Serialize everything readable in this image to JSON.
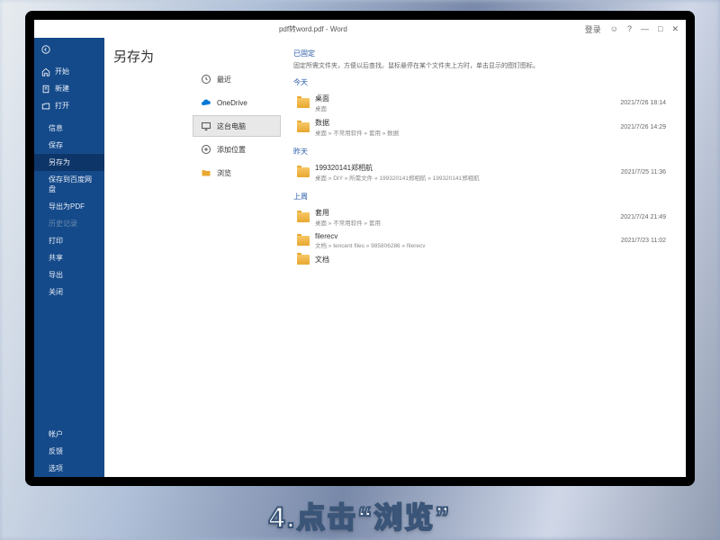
{
  "titlebar": {
    "doc": "pdf转word.pdf - Word",
    "login": "登录"
  },
  "sidebar": {
    "back": "",
    "top": [
      {
        "label": "开始"
      },
      {
        "label": "新建"
      },
      {
        "label": "打开"
      }
    ],
    "mid": [
      "信息",
      "保存",
      "另存为",
      "保存到百度网盘",
      "导出为PDF",
      "历史记录",
      "打印",
      "共享",
      "导出",
      "关闭"
    ],
    "bottom": [
      "帐户",
      "反馈",
      "选项"
    ],
    "active": "另存为"
  },
  "page": {
    "title": "另存为"
  },
  "nav": [
    {
      "label": "最近",
      "icon": "clock"
    },
    {
      "label": "OneDrive",
      "icon": "cloud"
    },
    {
      "label": "这台电脑",
      "icon": "pc",
      "selected": true
    },
    {
      "label": "添加位置",
      "icon": "plus"
    },
    {
      "label": "浏览",
      "icon": "folder"
    }
  ],
  "list": {
    "pinned_title": "已固定",
    "pinned_desc": "固定所需文件夹，方便以后查找。鼠标悬停在某个文件夹上方时，单击显示的图钉图标。",
    "sections": [
      {
        "label": "今天",
        "items": [
          {
            "name": "桌面",
            "path": "桌面",
            "date": "2021/7/26 18:14"
          },
          {
            "name": "数据",
            "path": "桌面 » 不常用软件 » 套用 » 数据",
            "date": "2021/7/26 14:29"
          }
        ]
      },
      {
        "label": "昨天",
        "items": [
          {
            "name": "199320141郑相航",
            "path": "桌面 » DIY » 所需文件 » 199320141郑相航 » 199320141郑相航",
            "date": "2021/7/25 11:36"
          }
        ]
      },
      {
        "label": "上周",
        "items": [
          {
            "name": "套用",
            "path": "桌面 » 不常用软件 » 套用",
            "date": "2021/7/24 21:49"
          },
          {
            "name": "filerecv",
            "path": "文档 » tencent files » 985806286 » filerecv",
            "date": "2021/7/23 11:02"
          },
          {
            "name": "文档",
            "path": "",
            "date": ""
          }
        ]
      }
    ]
  },
  "caption": "4.点击“浏览”"
}
